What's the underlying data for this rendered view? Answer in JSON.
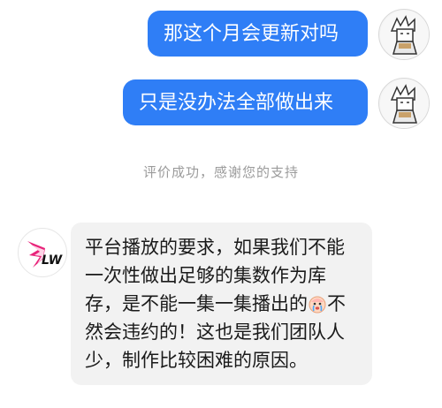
{
  "messages_out": [
    {
      "text": "那这个月会更新对吗"
    },
    {
      "text": "只是没办法全部做出来"
    }
  ],
  "system_notice": "评价成功，感谢您的支持",
  "reply": {
    "part1": "平台播放的要求，如果我们不能一次性做出足够的集数作为库存，是不能一集一集播出的",
    "emoji": "crying-baby-emoji",
    "part2": "不然会违约的！这也是我们团队人少，制作比较困难的原因。"
  },
  "avatars": {
    "user": "anime-character-avatar",
    "agent": "brand-logo-avatar",
    "agent_logo_text": "LW"
  },
  "colors": {
    "outgoing_bubble": "#2f7ef6",
    "incoming_bubble": "#f2f2f2",
    "notice_text": "#9b9b9b"
  }
}
